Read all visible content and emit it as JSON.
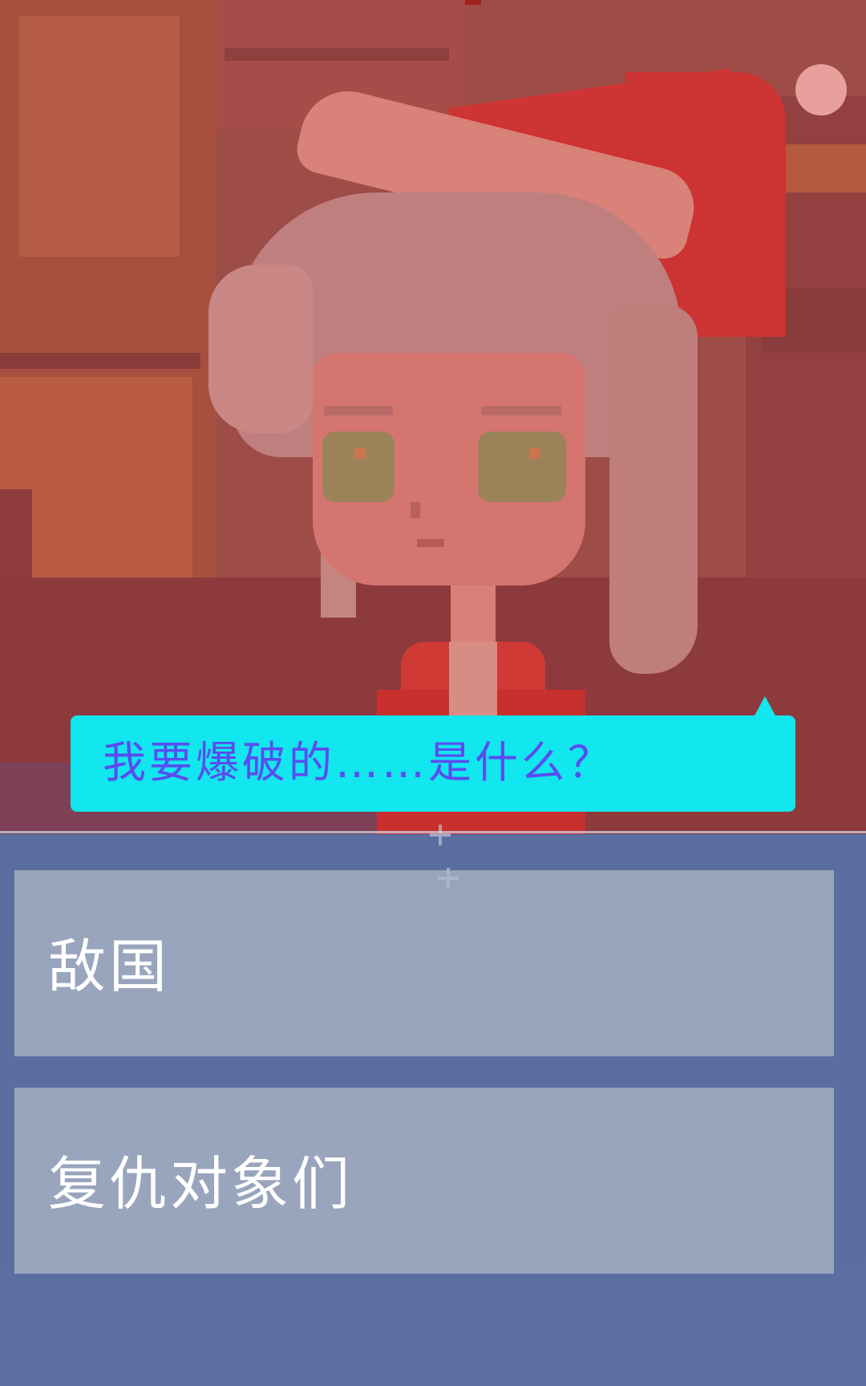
{
  "dialogue": {
    "text": "我要爆破的……是什么？"
  },
  "choices": [
    {
      "label": "敌国"
    },
    {
      "label": "复仇对象们"
    }
  ],
  "colors": {
    "bubble_bg": "#12e6ee",
    "bubble_text": "#5a4cf0",
    "choice_bg": "#b2bac8",
    "choice_text": "#ffffff",
    "lower_panel": "#5a6d9f"
  }
}
